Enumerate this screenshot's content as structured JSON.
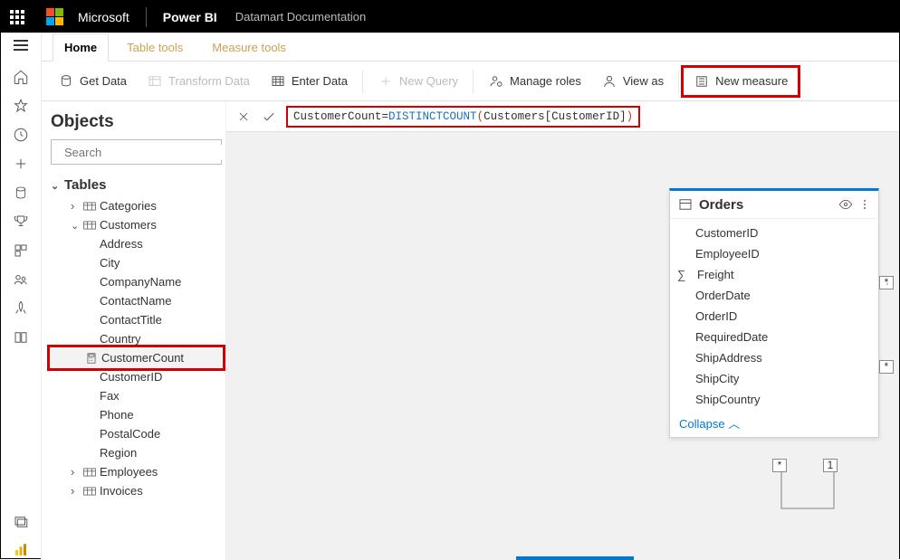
{
  "topbar": {
    "ms": "Microsoft",
    "prod": "Power BI",
    "doc": "Datamart Documentation"
  },
  "ribtabs": {
    "home": "Home",
    "table": "Table tools",
    "measure": "Measure tools"
  },
  "ribbon": {
    "get": "Get Data",
    "transform": "Transform Data",
    "enter": "Enter Data",
    "newq": "New Query",
    "roles": "Manage roles",
    "viewas": "View as",
    "newm": "New measure"
  },
  "objects": {
    "title": "Objects",
    "search_ph": "Search",
    "group": "Tables",
    "t0": "Categories",
    "t1": "Customers",
    "t2": "Employees",
    "t3": "Invoices",
    "c": {
      "0": "Address",
      "1": "City",
      "2": "CompanyName",
      "3": "ContactName",
      "4": "ContactTitle",
      "5": "Country",
      "6": "CustomerCount",
      "7": "CustomerID",
      "8": "Fax",
      "9": "Phone",
      "10": "PostalCode",
      "11": "Region"
    }
  },
  "formula": {
    "name": "CustomerCount",
    "eq": " = ",
    "fn": "DISTINCTCOUNT",
    "arg": "Customers[CustomerID]"
  },
  "orders": {
    "title": "Orders",
    "fields": {
      "0": "CustomerID",
      "1": "EmployeeID",
      "2": "Freight",
      "3": "OrderDate",
      "4": "OrderID",
      "5": "RequiredDate",
      "6": "ShipAddress",
      "7": "ShipCity",
      "8": "ShipCountry"
    },
    "collapse": "Collapse"
  },
  "markers": {
    "star": "*",
    "one": "1"
  }
}
